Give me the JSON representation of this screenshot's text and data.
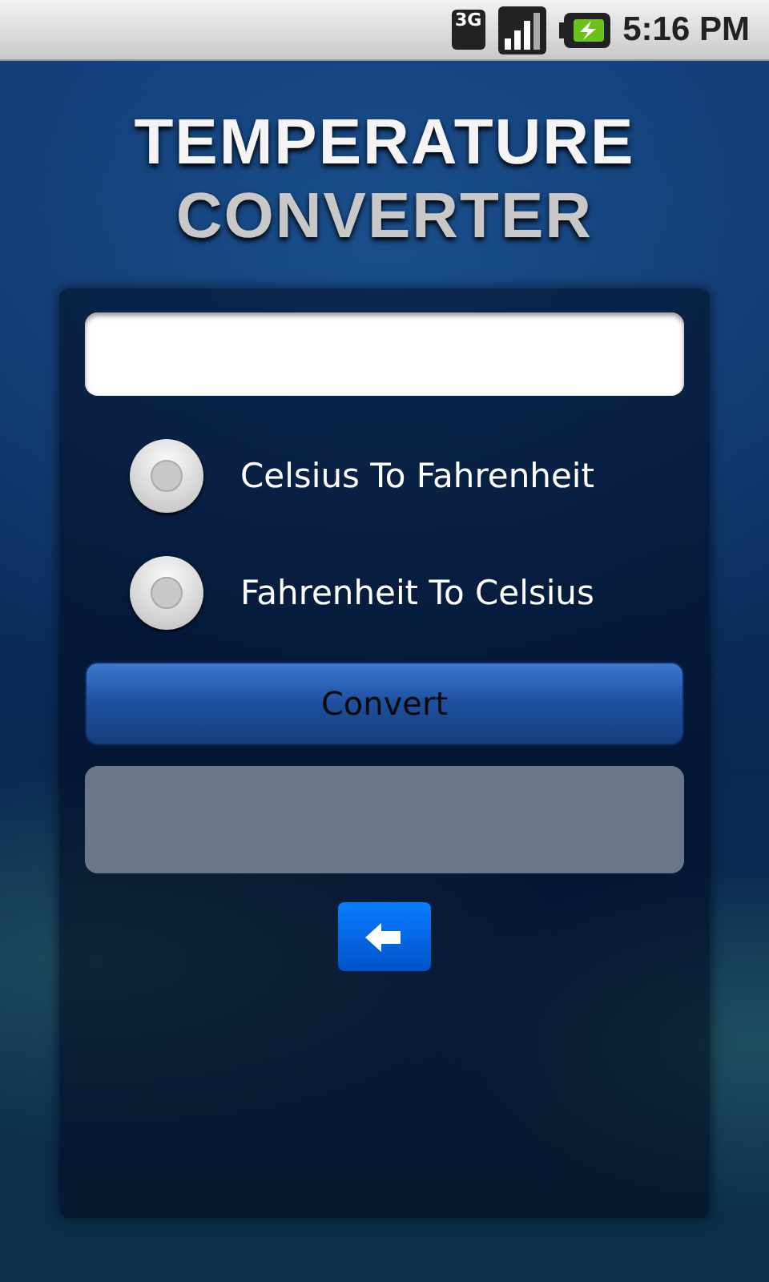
{
  "status_bar": {
    "network_type": "3G",
    "time": "5:16 PM"
  },
  "title": {
    "line_1": "TEMPERATURE",
    "line_2": "CONVERTER"
  },
  "options": [
    {
      "label": "Celsius To Fahrenheit",
      "selected": false
    },
    {
      "label": "Fahrenheit To Celsius",
      "selected": false
    }
  ],
  "convert_button": {
    "label": "Convert"
  }
}
